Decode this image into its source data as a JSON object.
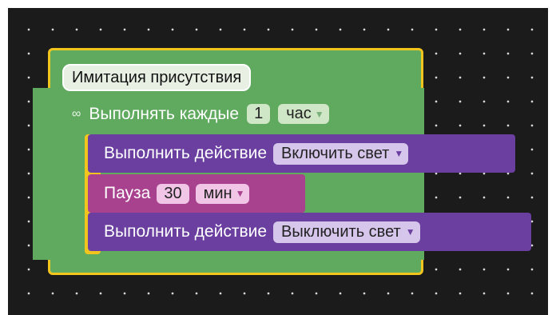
{
  "program": {
    "title": "Имитация присутствия",
    "repeat": {
      "label": "Выполнять каждые",
      "value": "1",
      "unit": "час",
      "icon": "repeat-icon"
    },
    "actions": [
      {
        "label": "Выполнить действие",
        "option": "Включить свет"
      },
      {
        "label": "Пауза",
        "value": "30",
        "unit": "мин"
      },
      {
        "label": "Выполнить действие",
        "option": "Выключить свет"
      }
    ]
  },
  "colors": {
    "workspace": "#1b1b1b",
    "event_block": "#5faa5f",
    "selected_outline": "#f2c51e",
    "action_block": "#6a3fa0",
    "pause_block": "#a8428e"
  }
}
